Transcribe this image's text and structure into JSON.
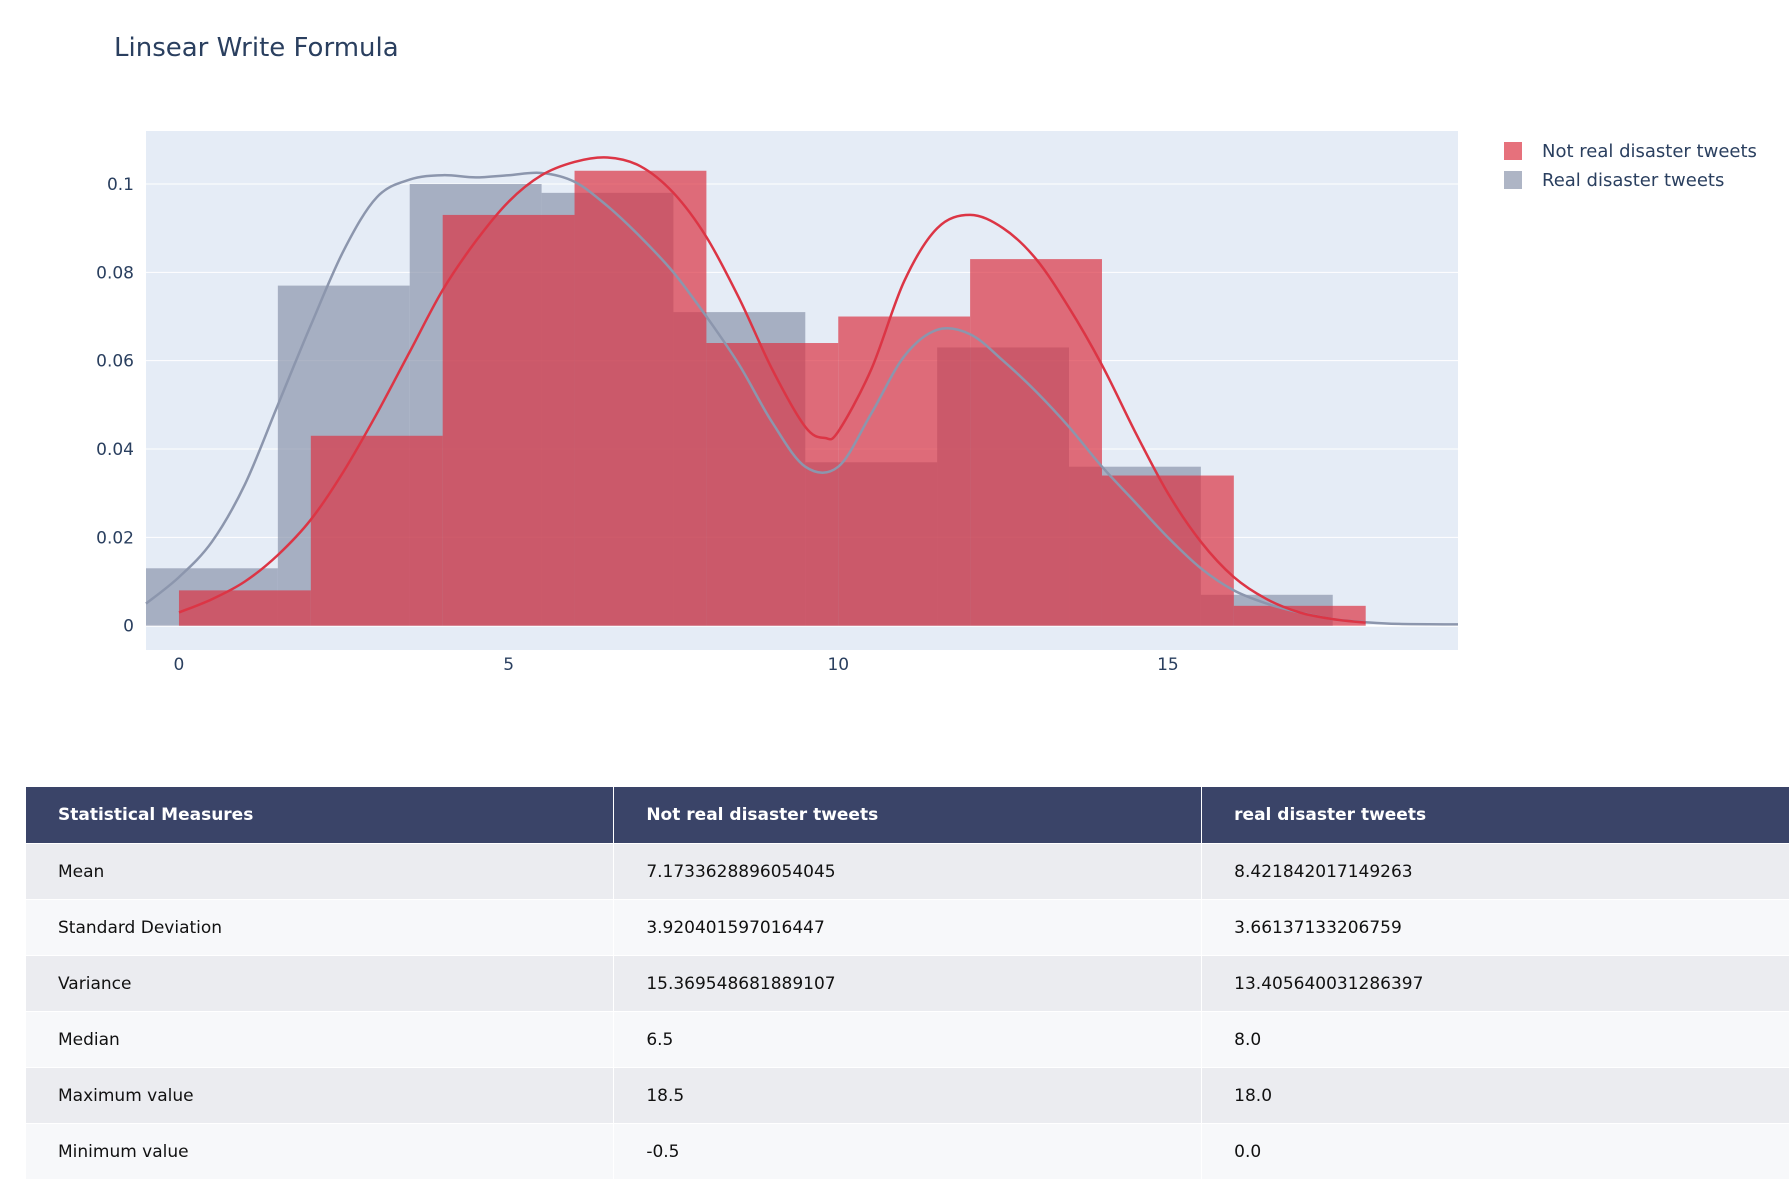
{
  "chart_data": {
    "type": "histogram",
    "title": "Linsear Write Formula",
    "xlim": [
      -0.5,
      19.4
    ],
    "ylim": [
      -0.0055,
      0.112
    ],
    "x_ticks": [
      0,
      5,
      10,
      15
    ],
    "y_ticks": [
      0,
      0.02,
      0.04,
      0.06,
      0.08,
      0.1
    ],
    "y_tick_labels": [
      "0",
      "0.02",
      "0.04",
      "0.06",
      "0.08",
      "0.1"
    ],
    "grid": true,
    "legend_position": "top-right",
    "series": [
      {
        "name": "Real disaster tweets",
        "color": "#8c96ad",
        "opacity": 0.7,
        "bins": [
          {
            "x0": -0.5,
            "x1": 1.5,
            "y": 0.013
          },
          {
            "x0": 1.5,
            "x1": 3.5,
            "y": 0.077
          },
          {
            "x0": 3.5,
            "x1": 5.5,
            "y": 0.1
          },
          {
            "x0": 5.5,
            "x1": 7.5,
            "y": 0.098
          },
          {
            "x0": 7.5,
            "x1": 9.5,
            "y": 0.071
          },
          {
            "x0": 9.5,
            "x1": 11.5,
            "y": 0.037
          },
          {
            "x0": 11.5,
            "x1": 13.5,
            "y": 0.063
          },
          {
            "x0": 13.5,
            "x1": 15.5,
            "y": 0.036
          },
          {
            "x0": 15.5,
            "x1": 17.5,
            "y": 0.007
          },
          {
            "x0": 17.5,
            "x1": 19.5,
            "y": 0
          }
        ],
        "curve": [
          [
            -0.5,
            0.005
          ],
          [
            0,
            0.011
          ],
          [
            0.5,
            0.019
          ],
          [
            1,
            0.032
          ],
          [
            1.5,
            0.05
          ],
          [
            2,
            0.068
          ],
          [
            2.5,
            0.085
          ],
          [
            3,
            0.097
          ],
          [
            3.5,
            0.101
          ],
          [
            4,
            0.102
          ],
          [
            4.5,
            0.1015
          ],
          [
            5,
            0.102
          ],
          [
            5.5,
            0.1025
          ],
          [
            6,
            0.1005
          ],
          [
            6.5,
            0.095
          ],
          [
            7,
            0.088
          ],
          [
            7.5,
            0.08
          ],
          [
            8,
            0.07
          ],
          [
            8.5,
            0.059
          ],
          [
            9,
            0.046
          ],
          [
            9.5,
            0.036
          ],
          [
            10,
            0.036
          ],
          [
            10.5,
            0.048
          ],
          [
            11,
            0.061
          ],
          [
            11.5,
            0.067
          ],
          [
            12,
            0.066
          ],
          [
            12.5,
            0.06
          ],
          [
            13,
            0.053
          ],
          [
            13.5,
            0.045
          ],
          [
            14,
            0.036
          ],
          [
            14.5,
            0.028
          ],
          [
            15,
            0.02
          ],
          [
            15.5,
            0.013
          ],
          [
            16,
            0.008
          ],
          [
            16.5,
            0.005
          ],
          [
            17,
            0.003
          ],
          [
            17.5,
            0.0015
          ],
          [
            18,
            0.0008
          ],
          [
            18.5,
            0.0004
          ],
          [
            19.4,
            0.0003
          ]
        ]
      },
      {
        "name": "Not real disaster tweets",
        "color": "#dc3545",
        "opacity": 0.7,
        "bins": [
          {
            "x0": 0,
            "x1": 2,
            "y": 0.008
          },
          {
            "x0": 2,
            "x1": 4,
            "y": 0.043
          },
          {
            "x0": 4,
            "x1": 6,
            "y": 0.093
          },
          {
            "x0": 6,
            "x1": 8,
            "y": 0.103
          },
          {
            "x0": 8,
            "x1": 10,
            "y": 0.064
          },
          {
            "x0": 10,
            "x1": 12,
            "y": 0.07
          },
          {
            "x0": 12,
            "x1": 14,
            "y": 0.083
          },
          {
            "x0": 14,
            "x1": 16,
            "y": 0.034
          },
          {
            "x0": 16,
            "x1": 18,
            "y": 0.0045
          }
        ],
        "curve": [
          [
            0,
            0.003
          ],
          [
            0.5,
            0.006
          ],
          [
            1,
            0.01
          ],
          [
            1.5,
            0.016
          ],
          [
            2,
            0.024
          ],
          [
            2.5,
            0.035
          ],
          [
            3,
            0.048
          ],
          [
            3.5,
            0.062
          ],
          [
            4,
            0.076
          ],
          [
            4.5,
            0.087
          ],
          [
            5,
            0.096
          ],
          [
            5.5,
            0.102
          ],
          [
            6,
            0.105
          ],
          [
            6.5,
            0.106
          ],
          [
            7,
            0.104
          ],
          [
            7.5,
            0.098
          ],
          [
            8,
            0.088
          ],
          [
            8.5,
            0.074
          ],
          [
            9,
            0.058
          ],
          [
            9.5,
            0.045
          ],
          [
            9.8,
            0.0425
          ],
          [
            10,
            0.044
          ],
          [
            10.5,
            0.058
          ],
          [
            11,
            0.078
          ],
          [
            11.5,
            0.09
          ],
          [
            12,
            0.093
          ],
          [
            12.5,
            0.09
          ],
          [
            13,
            0.083
          ],
          [
            13.5,
            0.072
          ],
          [
            14,
            0.059
          ],
          [
            14.5,
            0.044
          ],
          [
            15,
            0.03
          ],
          [
            15.5,
            0.019
          ],
          [
            16,
            0.011
          ],
          [
            16.5,
            0.006
          ],
          [
            17,
            0.003
          ],
          [
            17.5,
            0.0015
          ],
          [
            18,
            0.0007
          ]
        ]
      }
    ],
    "legend": [
      {
        "label": "Not real disaster tweets",
        "color": "#dc3545"
      },
      {
        "label": " Real disaster tweets",
        "color": "#8c96ad"
      }
    ]
  },
  "table": {
    "headers": [
      "Statistical Measures",
      "Not real disaster tweets",
      "real disaster tweets"
    ],
    "rows": [
      [
        "Mean",
        "7.1733628896054045",
        "8.421842017149263"
      ],
      [
        "Standard Deviation",
        "3.920401597016447",
        "3.66137133206759"
      ],
      [
        "Variance",
        "15.369548681889107",
        "13.405640031286397"
      ],
      [
        "Median",
        "6.5",
        "8.0"
      ],
      [
        "Maximum value",
        "18.5",
        "18.0"
      ],
      [
        "Minimum value",
        "-0.5",
        "0.0"
      ]
    ]
  }
}
